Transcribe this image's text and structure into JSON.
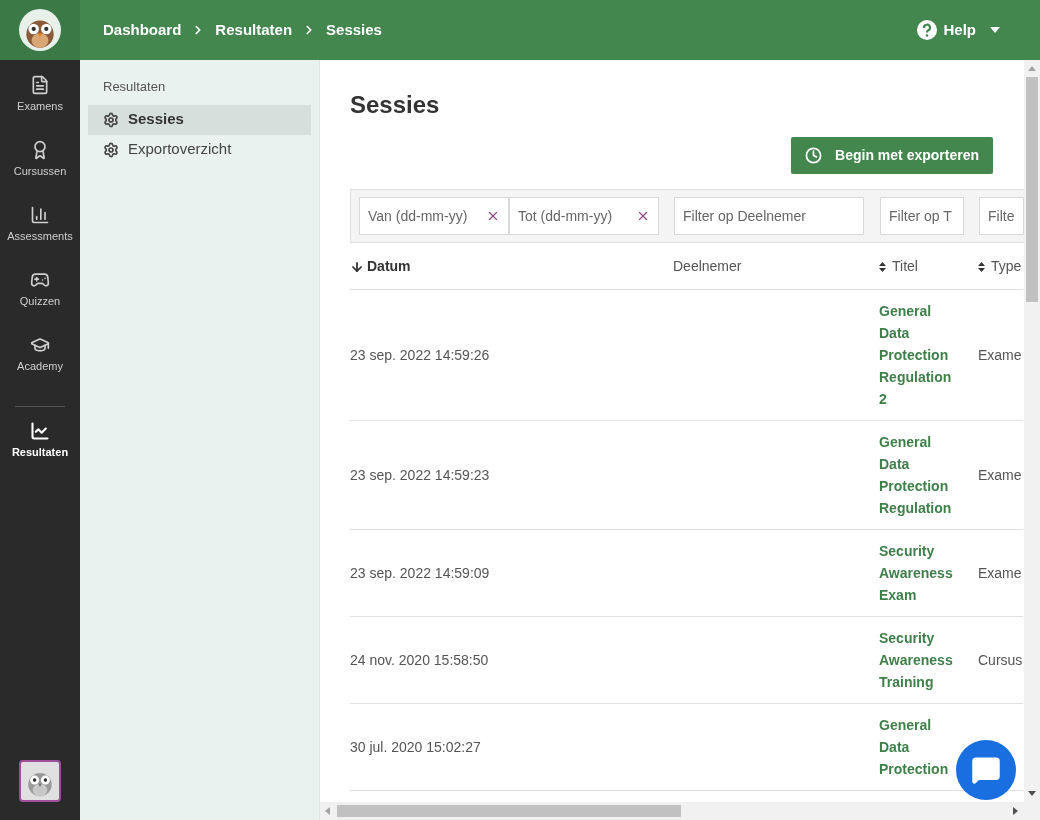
{
  "topbar": {
    "breadcrumbs": [
      {
        "label": "Dashboard"
      },
      {
        "label": "Resultaten"
      },
      {
        "label": "Sessies"
      }
    ],
    "help": "Help"
  },
  "rail": {
    "items": [
      {
        "label": "Examens",
        "selected": false
      },
      {
        "label": "Cursussen",
        "selected": false
      },
      {
        "label": "Assessments",
        "selected": false
      },
      {
        "label": "Quizzen",
        "selected": false
      },
      {
        "label": "Academy",
        "selected": false
      },
      {
        "label": "Resultaten",
        "selected": true
      }
    ]
  },
  "sidebar": {
    "heading": "Resultaten",
    "items": [
      {
        "label": "Sessies",
        "selected": true
      },
      {
        "label": "Exportoverzicht",
        "selected": false
      }
    ]
  },
  "page": {
    "title": "Sessies",
    "export_button": "Begin met exporteren"
  },
  "filters": [
    {
      "placeholder": "Van (dd-mm-yy)",
      "clearable": true
    },
    {
      "placeholder": "Tot (dd-mm-yy)",
      "clearable": true
    },
    {
      "placeholder": "Filter op Deelnemer",
      "clearable": false
    },
    {
      "placeholder": "Filter op T",
      "clearable": false
    },
    {
      "placeholder": "Filte",
      "clearable": false
    }
  ],
  "table": {
    "columns": [
      {
        "label": "Datum",
        "sortable": true,
        "sorted": true
      },
      {
        "label": "Deelnemer",
        "sortable": false,
        "sorted": false
      },
      {
        "label": "Titel",
        "sortable": true,
        "sorted": false
      },
      {
        "label": "Type",
        "sortable": true,
        "sorted": false
      }
    ],
    "rows": [
      {
        "date": "23 sep. 2022 14:59:26",
        "title": "General Data Protection Regulation 2",
        "type": "Exame"
      },
      {
        "date": "23 sep. 2022 14:59:23",
        "title": "General Data Protection Regulation",
        "type": "Exame"
      },
      {
        "date": "23 sep. 2022 14:59:09",
        "title": "Security Awareness Exam",
        "type": "Exame"
      },
      {
        "date": "24 nov. 2020 15:58:50",
        "title": "Security Awareness Training",
        "type": "Cursus"
      },
      {
        "date": "30 jul. 2020 15:02:27",
        "title": "General Data Protection"
      }
    ]
  }
}
